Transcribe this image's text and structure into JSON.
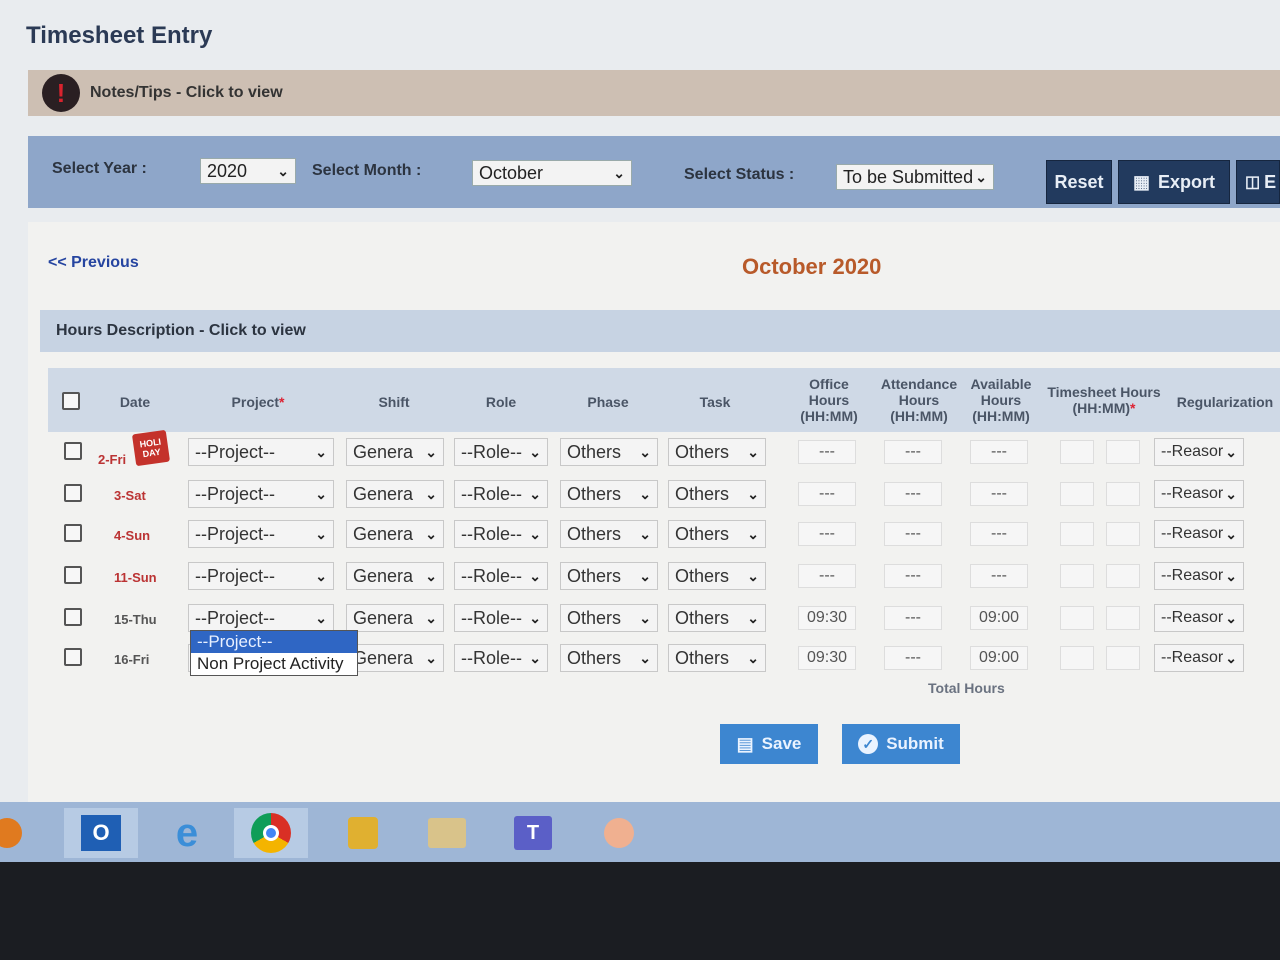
{
  "page": {
    "title": "Timesheet Entry"
  },
  "notes": {
    "text": "Notes/Tips - Click to view"
  },
  "filters": {
    "year_label": "Select Year :",
    "year_value": "2020",
    "month_label": "Select Month :",
    "month_value": "October",
    "status_label": "Select Status :",
    "status_value": "To be Submitted",
    "reset_label": "Reset",
    "export_label": "Export",
    "extra_label": "E"
  },
  "nav": {
    "previous": "<< Previous",
    "month_title": "October 2020"
  },
  "hours_desc": {
    "text": "Hours Description - Click to view"
  },
  "columns": {
    "date": "Date",
    "project": "Project",
    "project_req": "*",
    "shift": "Shift",
    "role": "Role",
    "phase": "Phase",
    "task": "Task",
    "office_1": "Office",
    "office_2": "Hours",
    "office_3": "(HH:MM)",
    "att_1": "Attendance",
    "att_2": "Hours",
    "att_3": "(HH:MM)",
    "avail_1": "Available",
    "avail_2": "Hours",
    "avail_3": "(HH:MM)",
    "ts_1": "Timesheet Hours",
    "ts_2": "(HH:MM)",
    "ts_req": "*",
    "regularization": "Regularization"
  },
  "holiday_badge": "HOLI DAY",
  "rows": [
    {
      "date": "2-Fri",
      "project": "--Project--",
      "shift": "Genera",
      "role": "--Role--",
      "phase": "Others",
      "task": "Others",
      "office": "---",
      "attendance": "---",
      "available": "---",
      "reason": "--Reasor"
    },
    {
      "date": "3-Sat",
      "project": "--Project--",
      "shift": "Genera",
      "role": "--Role--",
      "phase": "Others",
      "task": "Others",
      "office": "---",
      "attendance": "---",
      "available": "---",
      "reason": "--Reasor"
    },
    {
      "date": "4-Sun",
      "project": "--Project--",
      "shift": "Genera",
      "role": "--Role--",
      "phase": "Others",
      "task": "Others",
      "office": "---",
      "attendance": "---",
      "available": "---",
      "reason": "--Reasor"
    },
    {
      "date": "11-Sun",
      "project": "--Project--",
      "shift": "Genera",
      "role": "--Role--",
      "phase": "Others",
      "task": "Others",
      "office": "---",
      "attendance": "---",
      "available": "---",
      "reason": "--Reasor"
    },
    {
      "date": "15-Thu",
      "project": "--Project--",
      "shift": "Genera",
      "role": "--Role--",
      "phase": "Others",
      "task": "Others",
      "office": "09:30",
      "attendance": "---",
      "available": "09:00",
      "reason": "--Reasor"
    },
    {
      "date": "16-Fri",
      "project": "--Project--",
      "shift": "Genera",
      "role": "--Role--",
      "phase": "Others",
      "task": "Others",
      "office": "09:30",
      "attendance": "---",
      "available": "09:00",
      "reason": "--Reasor"
    }
  ],
  "project_dropdown": {
    "options": [
      "--Project--",
      "Non Project Activity"
    ]
  },
  "total_hours_label": "Total Hours",
  "actions": {
    "save": "Save",
    "submit": "Submit"
  },
  "colors": {
    "accent": "#3d86d0",
    "dark_button": "#223a5e",
    "month_title": "#b85a2a",
    "weekend_date": "#b33"
  }
}
